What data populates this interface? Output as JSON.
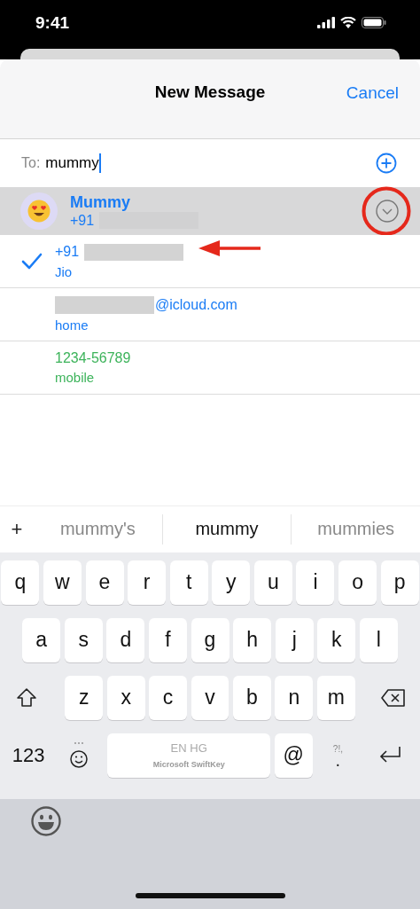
{
  "status_bar": {
    "time": "9:41"
  },
  "header": {
    "title": "New Message",
    "cancel": "Cancel"
  },
  "to_field": {
    "label": "To:",
    "value": "mummy"
  },
  "contact": {
    "name": "Mummy",
    "detail": "+91",
    "redacted_after": true,
    "circled": true
  },
  "entries": [
    {
      "value": "+91",
      "redacted_after": true,
      "label": "Jio",
      "selected": true,
      "color": "#1a7cf5",
      "pointed_at": true
    },
    {
      "value": "@icloud.com",
      "redacted_before": true,
      "label": "home",
      "selected": false,
      "color": "#1a7cf5",
      "pointed_at": false
    },
    {
      "value": "1234-56789",
      "label": "mobile",
      "selected": false,
      "color": "#3cb35a",
      "pointed_at": false
    }
  ],
  "suggestions": {
    "plus": "+",
    "words": [
      {
        "text": "mummy's",
        "selected": false
      },
      {
        "text": "mummy",
        "selected": true
      },
      {
        "text": "mummies",
        "selected": false
      }
    ]
  },
  "keyboard": {
    "key_rows": [
      {
        "keys": [
          {
            "kind": "letter",
            "text": "q"
          },
          {
            "kind": "letter",
            "text": "w"
          },
          {
            "kind": "letter",
            "text": "e"
          },
          {
            "kind": "letter",
            "text": "r"
          },
          {
            "kind": "letter",
            "text": "t"
          },
          {
            "kind": "letter",
            "text": "y"
          },
          {
            "kind": "letter",
            "text": "u"
          },
          {
            "kind": "letter",
            "text": "i"
          },
          {
            "kind": "letter",
            "text": "o"
          },
          {
            "kind": "letter",
            "text": "p"
          }
        ]
      },
      {
        "keys": [
          {
            "kind": "letter",
            "text": "a"
          },
          {
            "kind": "letter",
            "text": "s"
          },
          {
            "kind": "letter",
            "text": "d"
          },
          {
            "kind": "letter",
            "text": "f"
          },
          {
            "kind": "letter",
            "text": "g"
          },
          {
            "kind": "letter",
            "text": "h"
          },
          {
            "kind": "letter",
            "text": "j"
          },
          {
            "kind": "letter",
            "text": "k"
          },
          {
            "kind": "letter",
            "text": "l"
          }
        ]
      },
      {
        "keys": [
          {
            "kind": "shift"
          },
          {
            "kind": "letter",
            "text": "z"
          },
          {
            "kind": "letter",
            "text": "x"
          },
          {
            "kind": "letter",
            "text": "c"
          },
          {
            "kind": "letter",
            "text": "v"
          },
          {
            "kind": "letter",
            "text": "b"
          },
          {
            "kind": "letter",
            "text": "n"
          },
          {
            "kind": "letter",
            "text": "m"
          },
          {
            "kind": "delete"
          }
        ]
      },
      {
        "keys": [
          {
            "kind": "numbers",
            "text": "123"
          },
          {
            "kind": "emoji"
          },
          {
            "kind": "space",
            "text": "EN HG",
            "subtext": "Microsoft SwiftKey"
          },
          {
            "kind": "at",
            "text": "@"
          },
          {
            "kind": "punct",
            "text": ".",
            "subtext": "?!,"
          },
          {
            "kind": "return"
          }
        ]
      }
    ]
  }
}
